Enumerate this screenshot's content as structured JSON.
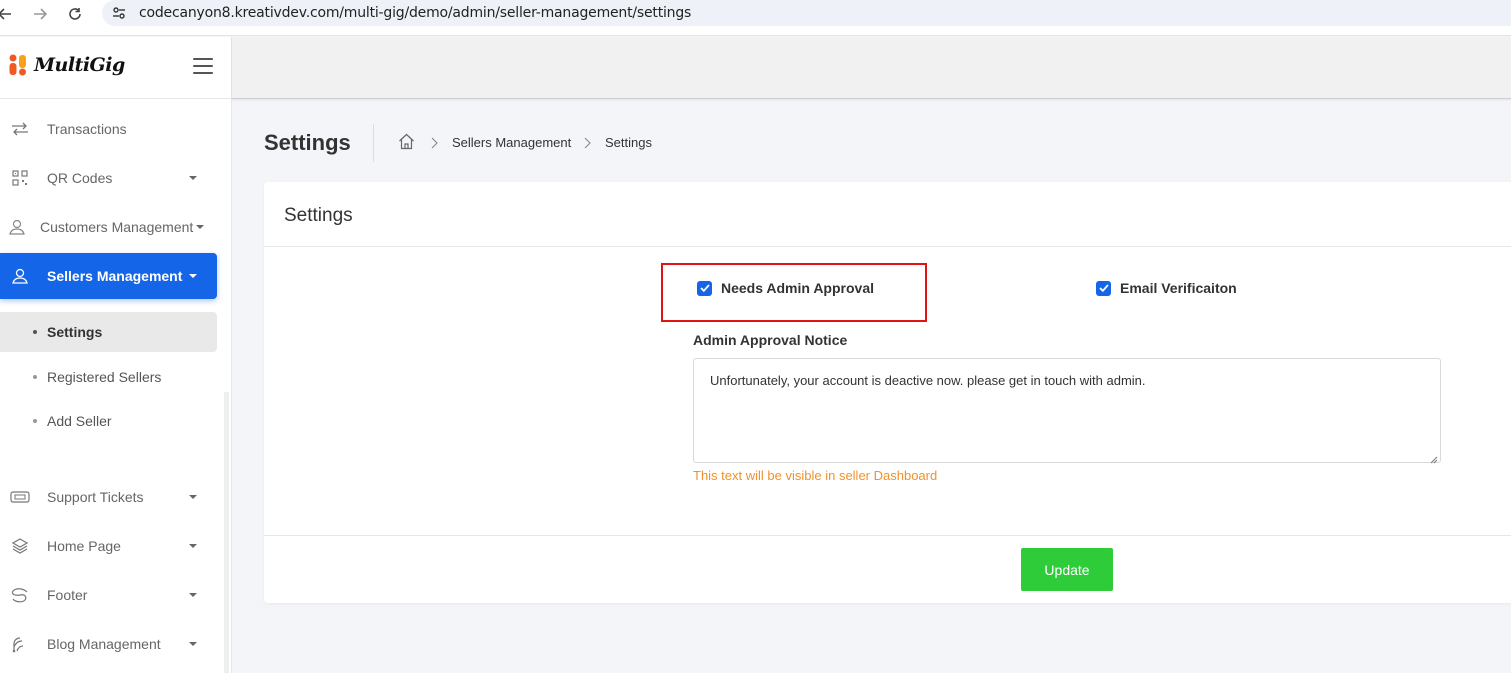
{
  "browser": {
    "url": "codecanyon8.kreativdev.com/multi-gig/demo/admin/seller-management/settings"
  },
  "app": {
    "logo_text": "MultiGig"
  },
  "sidebar": {
    "items": [
      {
        "label": "Transactions",
        "icon": "transactions-icon"
      },
      {
        "label": "QR Codes",
        "icon": "qr-code-icon"
      },
      {
        "label": "Customers Management",
        "icon": "customers-icon"
      },
      {
        "label": "Sellers Management",
        "icon": "sellers-icon"
      },
      {
        "label": "Support Tickets",
        "icon": "ticket-icon"
      },
      {
        "label": "Home Page",
        "icon": "layers-icon"
      },
      {
        "label": "Footer",
        "icon": "footer-icon"
      },
      {
        "label": "Blog Management",
        "icon": "blog-icon"
      }
    ],
    "sub_items": [
      {
        "label": "Settings"
      },
      {
        "label": "Registered Sellers"
      },
      {
        "label": "Add Seller"
      }
    ]
  },
  "page": {
    "title": "Settings",
    "breadcrumb": [
      "Sellers Management",
      "Settings"
    ]
  },
  "card": {
    "title": "Settings",
    "needs_admin_approval": {
      "label": "Needs Admin Approval",
      "checked": true
    },
    "email_verification": {
      "label": "Email Verificaiton",
      "checked": true
    },
    "notice_label": "Admin Approval Notice",
    "notice_value": "Unfortunately, your account is deactive now. please get in touch with admin.",
    "notice_help": "This text will be visible in seller Dashboard",
    "update_label": "Update"
  },
  "colors": {
    "primary": "#1565e8",
    "success": "#2fcc3a",
    "warning_text": "#f0922b",
    "highlight": "#e01414"
  }
}
